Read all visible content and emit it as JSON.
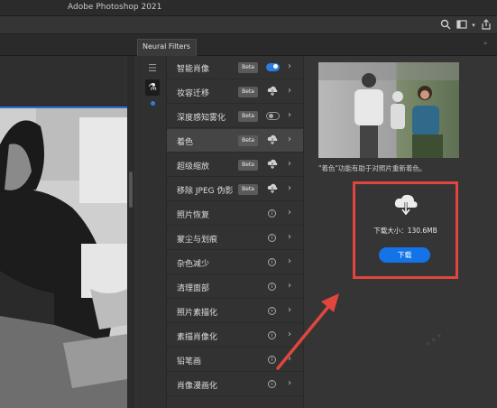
{
  "window": {
    "title": "Adobe Photoshop 2021"
  },
  "toolbar_icons": [
    "search-icon",
    "workspace-icon",
    "share-icon"
  ],
  "panel_tab": {
    "label": "Neural Filters"
  },
  "side_rail": {
    "icons": [
      "all-filters-icon",
      "beta-flask-icon"
    ]
  },
  "filters": [
    {
      "label": "智能肖像",
      "badge": "Beta",
      "control": "toggle-on"
    },
    {
      "label": "妆容迁移",
      "badge": "Beta",
      "control": "cloud"
    },
    {
      "label": "深度感知雾化",
      "badge": "Beta",
      "control": "toggle-off"
    },
    {
      "label": "着色",
      "badge": "Beta",
      "control": "cloud",
      "selected": true
    },
    {
      "label": "超级缩放",
      "badge": "Beta",
      "control": "cloud"
    },
    {
      "label": "移除 JPEG 伪影",
      "badge": "Beta",
      "control": "cloud"
    },
    {
      "label": "照片恢复",
      "badge": "",
      "control": "info"
    },
    {
      "label": "蒙尘与划痕",
      "badge": "",
      "control": "info"
    },
    {
      "label": "杂色减少",
      "badge": "",
      "control": "info"
    },
    {
      "label": "清理面部",
      "badge": "",
      "control": "info"
    },
    {
      "label": "照片素描化",
      "badge": "",
      "control": "info"
    },
    {
      "label": "素描肖像化",
      "badge": "",
      "control": "info"
    },
    {
      "label": "铅笔画",
      "badge": "",
      "control": "info"
    },
    {
      "label": "肖像漫画化",
      "badge": "",
      "control": "info"
    }
  ],
  "detail": {
    "caption": "\"着色\"功能有助于对照片重新着色。",
    "download_size": "下载大小：130.6MB",
    "download_button": "下载"
  },
  "colors": {
    "accent": "#1473e6",
    "highlight_box": "#e0463d",
    "toggle_on": "#2d7de0"
  }
}
